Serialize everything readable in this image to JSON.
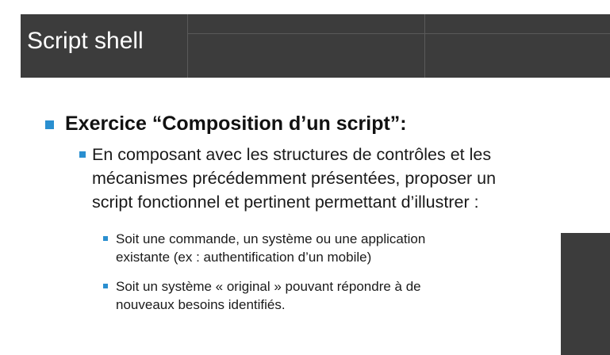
{
  "slide": {
    "title": "Script shell",
    "heading": "Exercice “Composition d’un script”:",
    "body_lines": [
      "En composant avec les structures de contrôles et les",
      "mécanismes précédemment présentées, proposer un",
      "script fonctionnel et pertinent permettant d’illustrer :"
    ],
    "sub_items": [
      {
        "lines": [
          "Soit une commande, un système ou une application",
          "existante (ex : authentification d’un mobile)"
        ]
      },
      {
        "lines": [
          "Soit un système « original » pouvant répondre à de",
          "nouveaux besoins identifiés."
        ]
      }
    ]
  },
  "colors": {
    "title_bar": "#3c3c3c",
    "bullet": "#2a8fd0",
    "title_text": "#ffffff"
  }
}
